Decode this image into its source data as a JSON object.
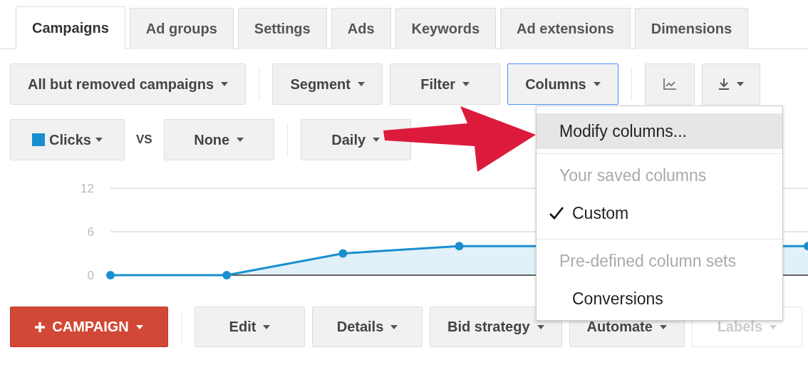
{
  "tabs": [
    {
      "label": "Campaigns",
      "selected": true
    },
    {
      "label": "Ad groups",
      "selected": false
    },
    {
      "label": "Settings",
      "selected": false
    },
    {
      "label": "Ads",
      "selected": false
    },
    {
      "label": "Keywords",
      "selected": false
    },
    {
      "label": "Ad extensions",
      "selected": false
    },
    {
      "label": "Dimensions",
      "selected": false
    }
  ],
  "toolbar_groups": [
    {
      "buttons": [
        {
          "kind": "dropdown",
          "label": "All but removed campaigns",
          "open": false
        }
      ]
    },
    {
      "buttons": [
        {
          "kind": "dropdown",
          "label": "Segment",
          "open": false
        },
        {
          "kind": "dropdown",
          "label": "Filter",
          "open": false
        },
        {
          "kind": "dropdown",
          "label": "Columns",
          "open": true
        }
      ]
    },
    {
      "buttons": [
        {
          "kind": "chart",
          "open": false
        },
        {
          "kind": "download",
          "open": false
        }
      ]
    }
  ],
  "metrics": {
    "primary": {
      "label": "Clicks",
      "color": "#1a8fd0"
    },
    "vs": "VS",
    "secondary": "None",
    "period": "Daily"
  },
  "chart_data": {
    "type": "area",
    "series": [
      {
        "color": "#1a8fd0",
        "values": [
          0,
          0,
          3,
          4,
          null,
          null,
          4
        ]
      }
    ],
    "yticks": [
      0,
      6,
      12
    ],
    "ylim": [
      0,
      12
    ]
  },
  "columns_menu": [
    {
      "kind": "action",
      "label": "Modify columns...",
      "highlighted": true
    },
    {
      "kind": "header",
      "label": "Your saved columns"
    },
    {
      "kind": "option",
      "label": "Custom",
      "checked": true
    },
    {
      "kind": "header",
      "label": "Pre-defined column sets"
    },
    {
      "kind": "option",
      "label": "Conversions",
      "checked": false
    }
  ],
  "bottom_toolbar": [
    {
      "kind": "primary",
      "label": "CAMPAIGN",
      "disabled": false
    },
    {
      "kind": "dropdown",
      "label": "Edit",
      "disabled": false
    },
    {
      "kind": "dropdown",
      "label": "Details",
      "disabled": false
    },
    {
      "kind": "dropdown",
      "label": "Bid strategy",
      "disabled": false
    },
    {
      "kind": "dropdown",
      "label": "Automate",
      "disabled": false
    },
    {
      "kind": "dropdown",
      "label": "Labels",
      "disabled": true
    }
  ]
}
